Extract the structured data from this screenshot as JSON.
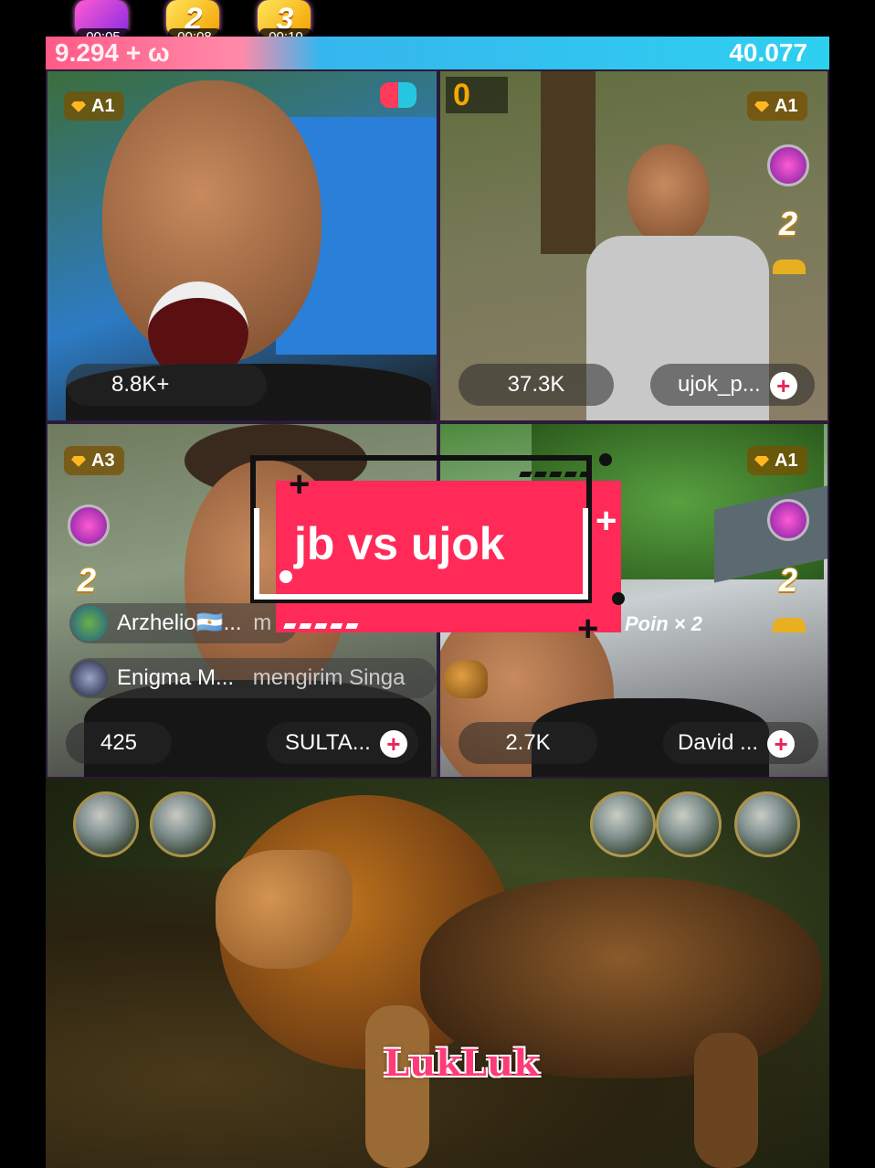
{
  "boosters": [
    {
      "label": "",
      "timer": "00:05"
    },
    {
      "label": "2",
      "timer": "00:08"
    },
    {
      "label": "3",
      "timer": "00:10"
    }
  ],
  "score": {
    "left": "9.294 + ω",
    "right": "40.077"
  },
  "tiles": {
    "t1": {
      "badge": "A1",
      "viewers": "8.8K+"
    },
    "t2": {
      "points": "0",
      "badge": "A1",
      "viewers": "37.3K",
      "username": "ujok_p..."
    },
    "t3": {
      "badge": "A3",
      "viewers": "425",
      "username": "SULTA..."
    },
    "t4": {
      "badge": "A1",
      "viewers": "2.7K",
      "username": "David ...",
      "poin": "Poin × 2"
    }
  },
  "comments": [
    {
      "user": "Arzhelio🇦🇷...",
      "text": "m"
    },
    {
      "user": "Enigma M...",
      "text": "mengirim Singa"
    }
  ],
  "overlay": {
    "title": "jb vs ujok"
  },
  "watermark": "LukLuk"
}
